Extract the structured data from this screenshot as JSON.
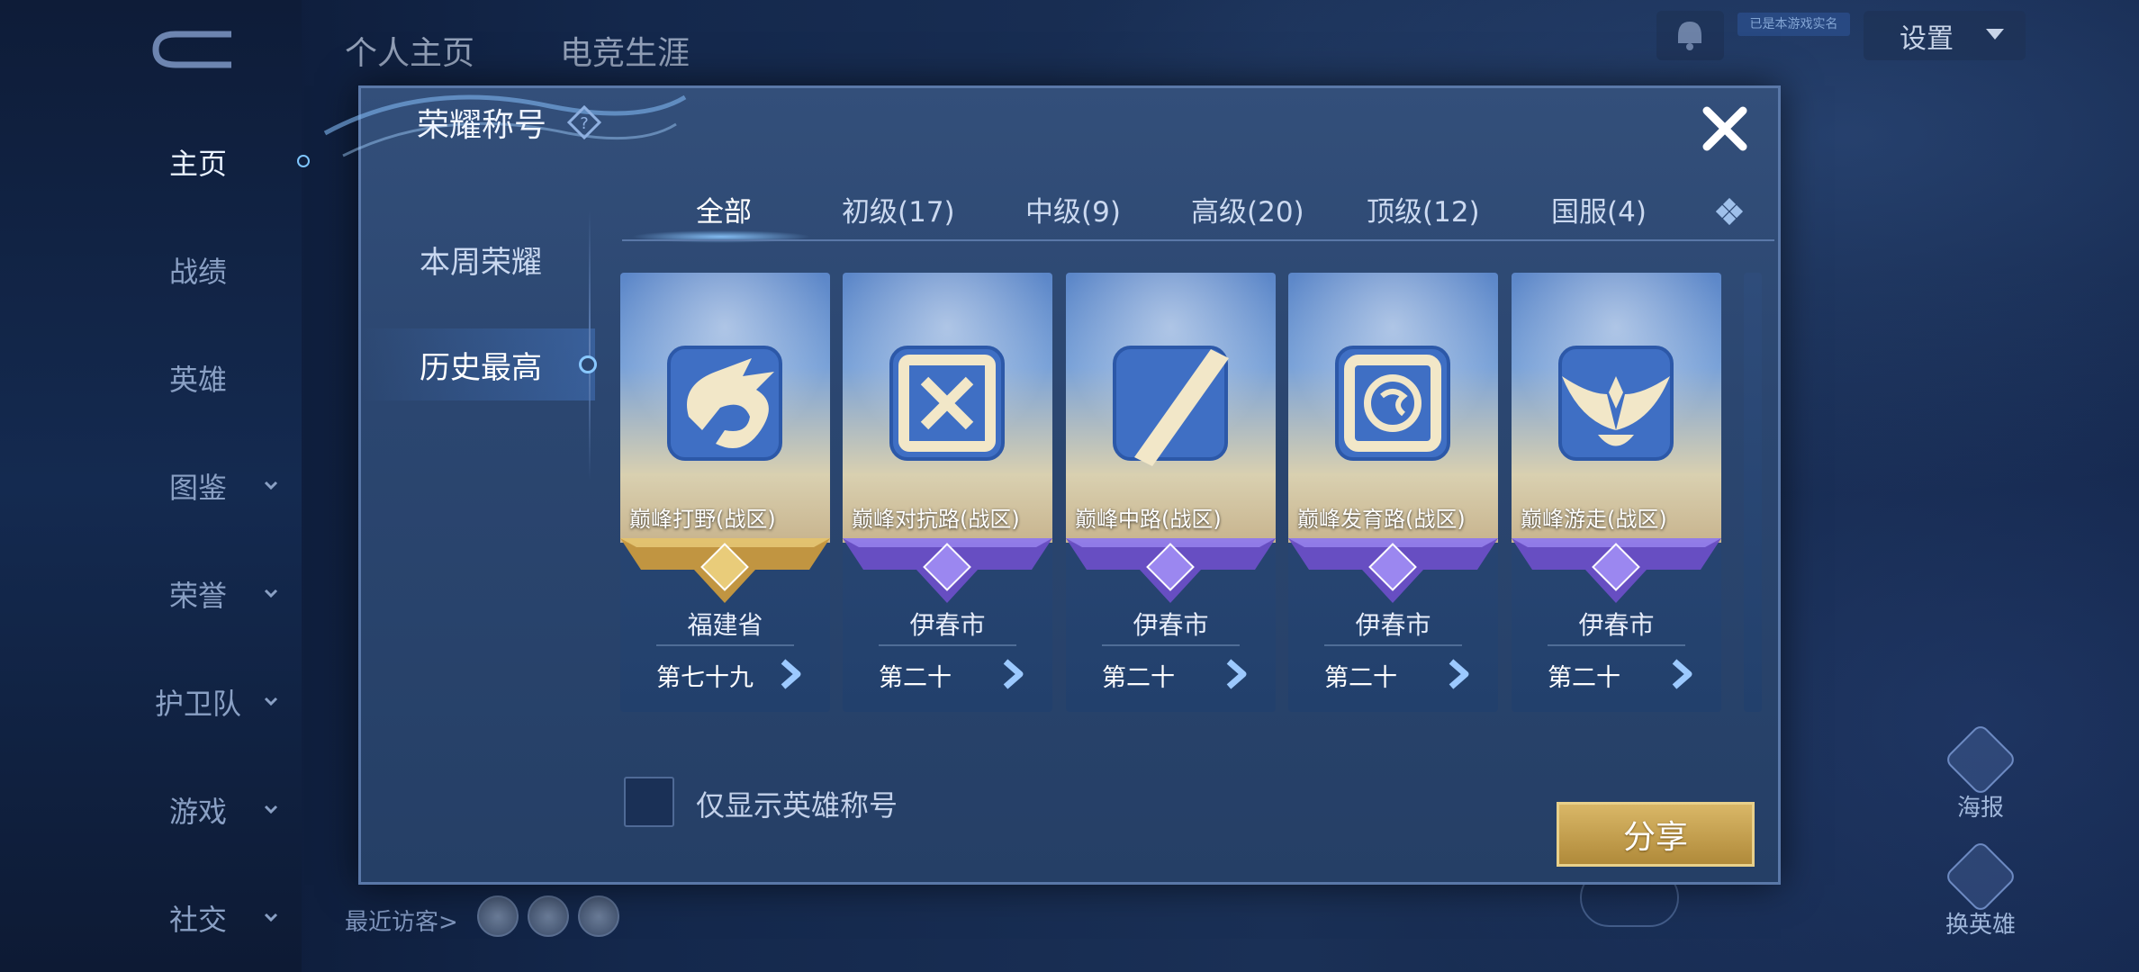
{
  "background": {
    "top_tabs": [
      "个人主页",
      "电竞生涯"
    ],
    "left_nav": [
      {
        "label": "主页",
        "active": true,
        "has_chevron": false
      },
      {
        "label": "战绩",
        "active": false,
        "has_chevron": false
      },
      {
        "label": "英雄",
        "active": false,
        "has_chevron": false
      },
      {
        "label": "图鉴",
        "active": false,
        "has_chevron": true
      },
      {
        "label": "荣誉",
        "active": false,
        "has_chevron": true
      },
      {
        "label": "护卫队",
        "active": false,
        "has_chevron": true
      },
      {
        "label": "游戏",
        "active": false,
        "has_chevron": true
      },
      {
        "label": "社交",
        "active": false,
        "has_chevron": true
      }
    ],
    "settings_label": "设置",
    "tiny_label": "已是本游戏实名",
    "poster_label": "海报",
    "change_hero_label": "换英雄",
    "recent_visitors_label": "最近访客>"
  },
  "dialog": {
    "title": "荣耀称号",
    "left_tabs": [
      {
        "label": "本周荣耀",
        "active": false
      },
      {
        "label": "历史最高",
        "active": true
      }
    ],
    "categories": [
      {
        "label": "全部",
        "active": true
      },
      {
        "label": "初级(17)",
        "active": false
      },
      {
        "label": "中级(9)",
        "active": false
      },
      {
        "label": "高级(20)",
        "active": false
      },
      {
        "label": "顶级(12)",
        "active": false
      },
      {
        "label": "国服(4)",
        "active": false
      }
    ],
    "cards": [
      {
        "title": "巅峰打野(战区)",
        "region": "福建省",
        "rank": "第七十九",
        "tier": "gold",
        "emblem": "dragon"
      },
      {
        "title": "巅峰对抗路(战区)",
        "region": "伊春市",
        "rank": "第二十",
        "tier": "purple",
        "emblem": "swords"
      },
      {
        "title": "巅峰中路(战区)",
        "region": "伊春市",
        "rank": "第二十",
        "tier": "purple",
        "emblem": "slash"
      },
      {
        "title": "巅峰发育路(战区)",
        "region": "伊春市",
        "rank": "第二十",
        "tier": "purple",
        "emblem": "target"
      },
      {
        "title": "巅峰游走(战区)",
        "region": "伊春市",
        "rank": "第二十",
        "tier": "purple",
        "emblem": "wings"
      }
    ],
    "filter_checkbox_label": "仅显示英雄称号",
    "filter_checked": false,
    "share_label": "分享"
  },
  "colors": {
    "gold_ribbon": "#c99a3e",
    "purple_ribbon": "#7b5fd6",
    "share_button": "#c9a455",
    "active_highlight": "#89c8ff"
  }
}
